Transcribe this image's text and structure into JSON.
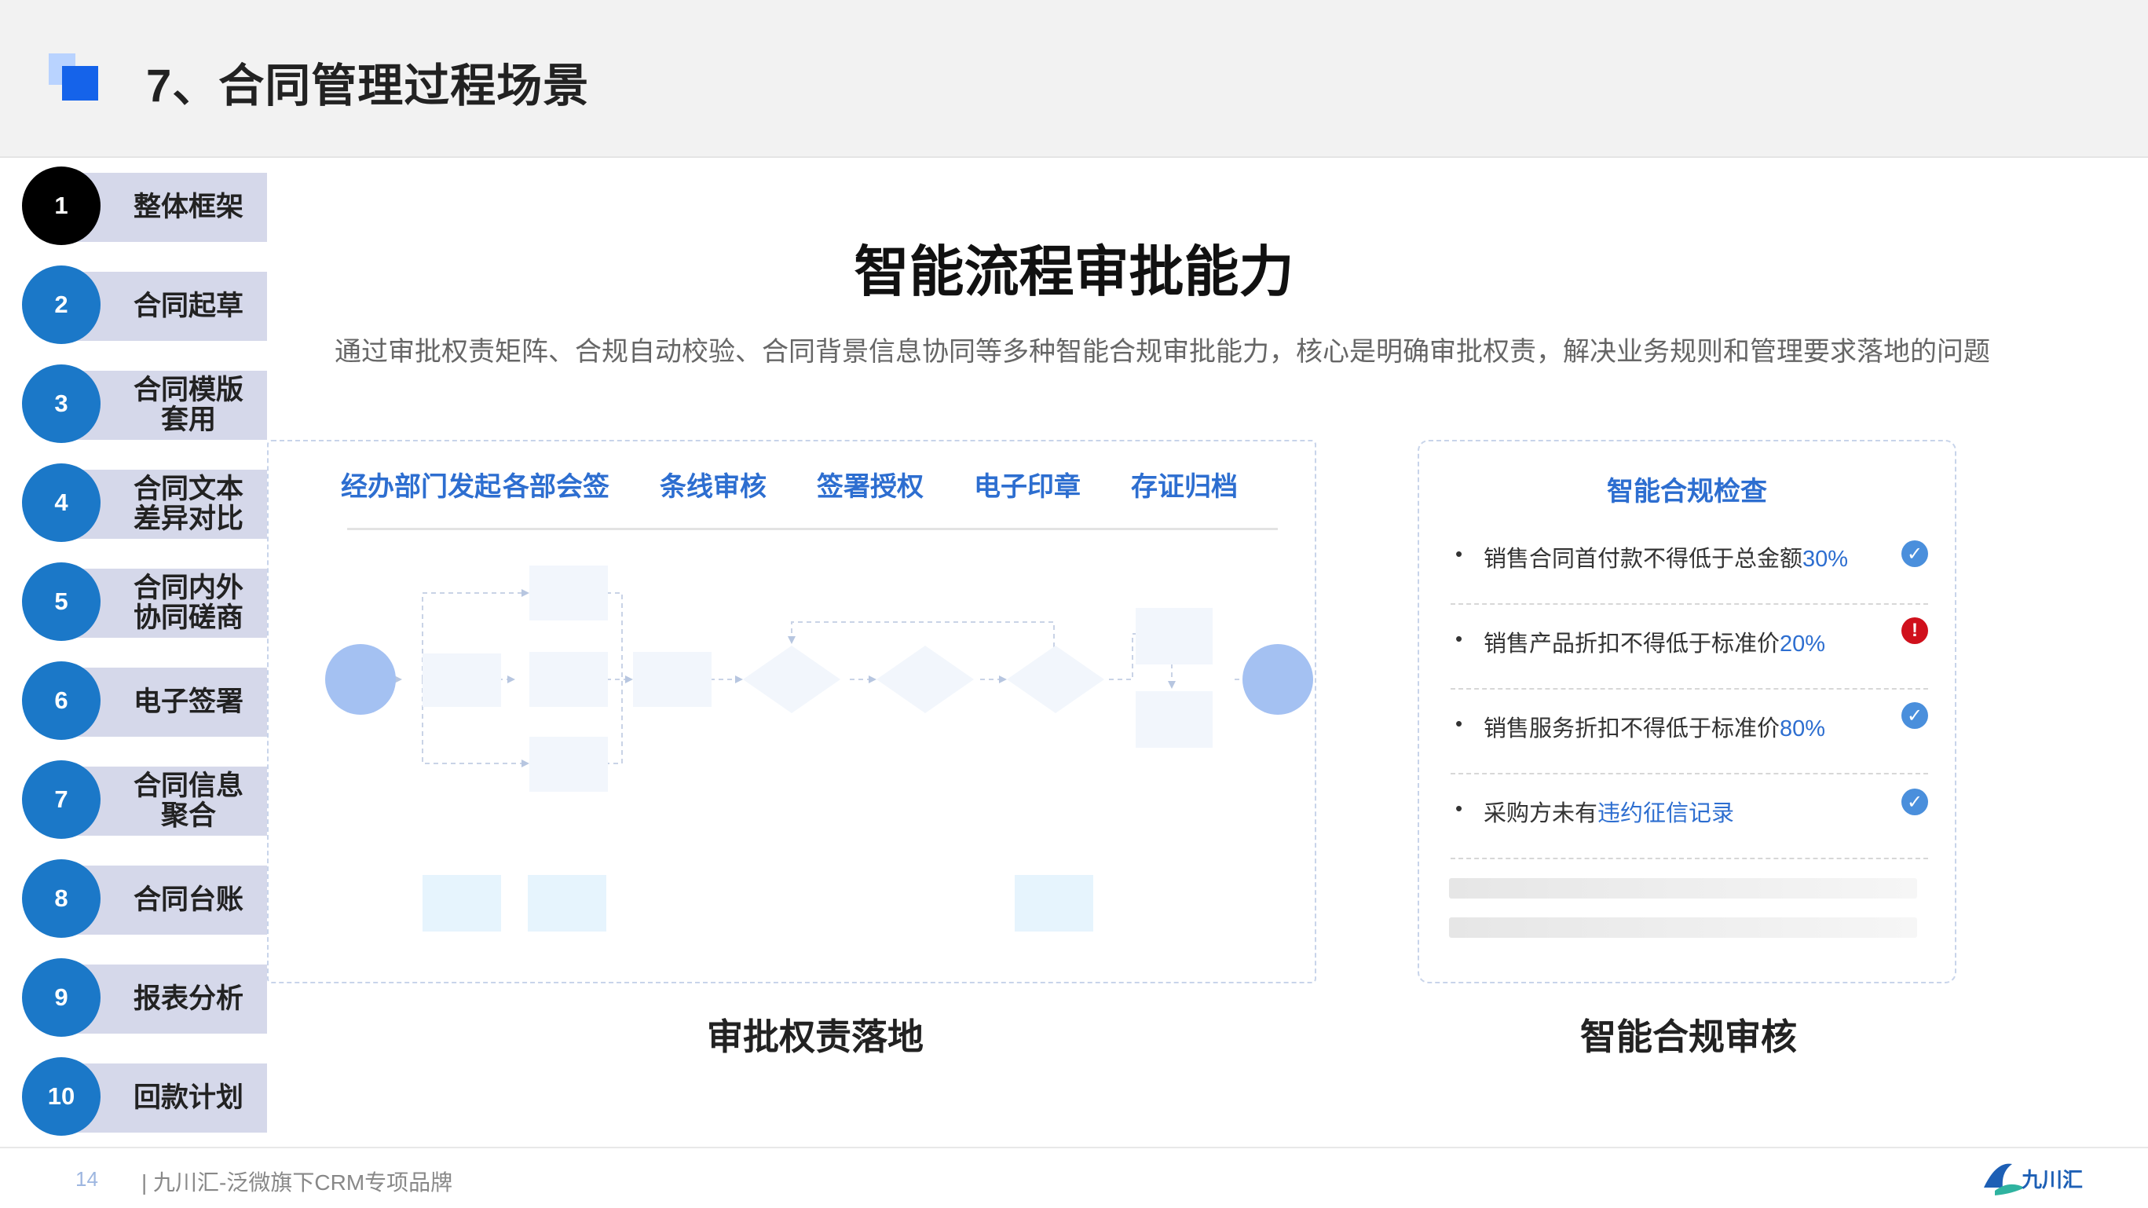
{
  "header": {
    "title": "7、合同管理过程场景"
  },
  "sidebar": {
    "items": [
      {
        "num": "1",
        "label": "整体框架",
        "active": true
      },
      {
        "num": "2",
        "label": "合同起草"
      },
      {
        "num": "3",
        "label": "合同模版\n套用"
      },
      {
        "num": "4",
        "label": "合同文本\n差异对比"
      },
      {
        "num": "5",
        "label": "合同内外\n协同磋商"
      },
      {
        "num": "6",
        "label": "电子签署"
      },
      {
        "num": "7",
        "label": "合同信息\n聚合"
      },
      {
        "num": "8",
        "label": "合同台账"
      },
      {
        "num": "9",
        "label": "报表分析"
      },
      {
        "num": "10",
        "label": "回款计划"
      }
    ]
  },
  "main": {
    "title": "智能流程审批能力",
    "subtitle": "通过审批权责矩阵、合规自动校验、合同背景信息协同等多种智能合规审批能力，核心是明确审批权责，解决业务规则和管理要求落地的问题"
  },
  "flow": {
    "steps": [
      "经办部门发起",
      "各部会签",
      "条线审核",
      "签署授权",
      "电子印章",
      "存证归档"
    ],
    "caption": "审批权责落地"
  },
  "compliance": {
    "title": "智能合规检查",
    "items": [
      {
        "text": "销售合同首付款不得低于总金额",
        "highlight": "30%",
        "status": "ok"
      },
      {
        "text": "销售产品折扣不得低于标准价",
        "highlight": "20%",
        "status": "error"
      },
      {
        "text": "销售服务折扣不得低于标准价",
        "highlight": "80%",
        "status": "ok"
      },
      {
        "text": "采购方未有",
        "highlight": "违约征信记录",
        "status": "ok"
      }
    ],
    "caption": "智能合规审核"
  },
  "footer": {
    "page": "14",
    "text": "| 九川汇-泛微旗下CRM专项品牌",
    "brand": "九川汇"
  },
  "colors": {
    "accent": "#2d6ed0",
    "sidebar_circle": "#1b78c8",
    "error": "#d0101c"
  }
}
